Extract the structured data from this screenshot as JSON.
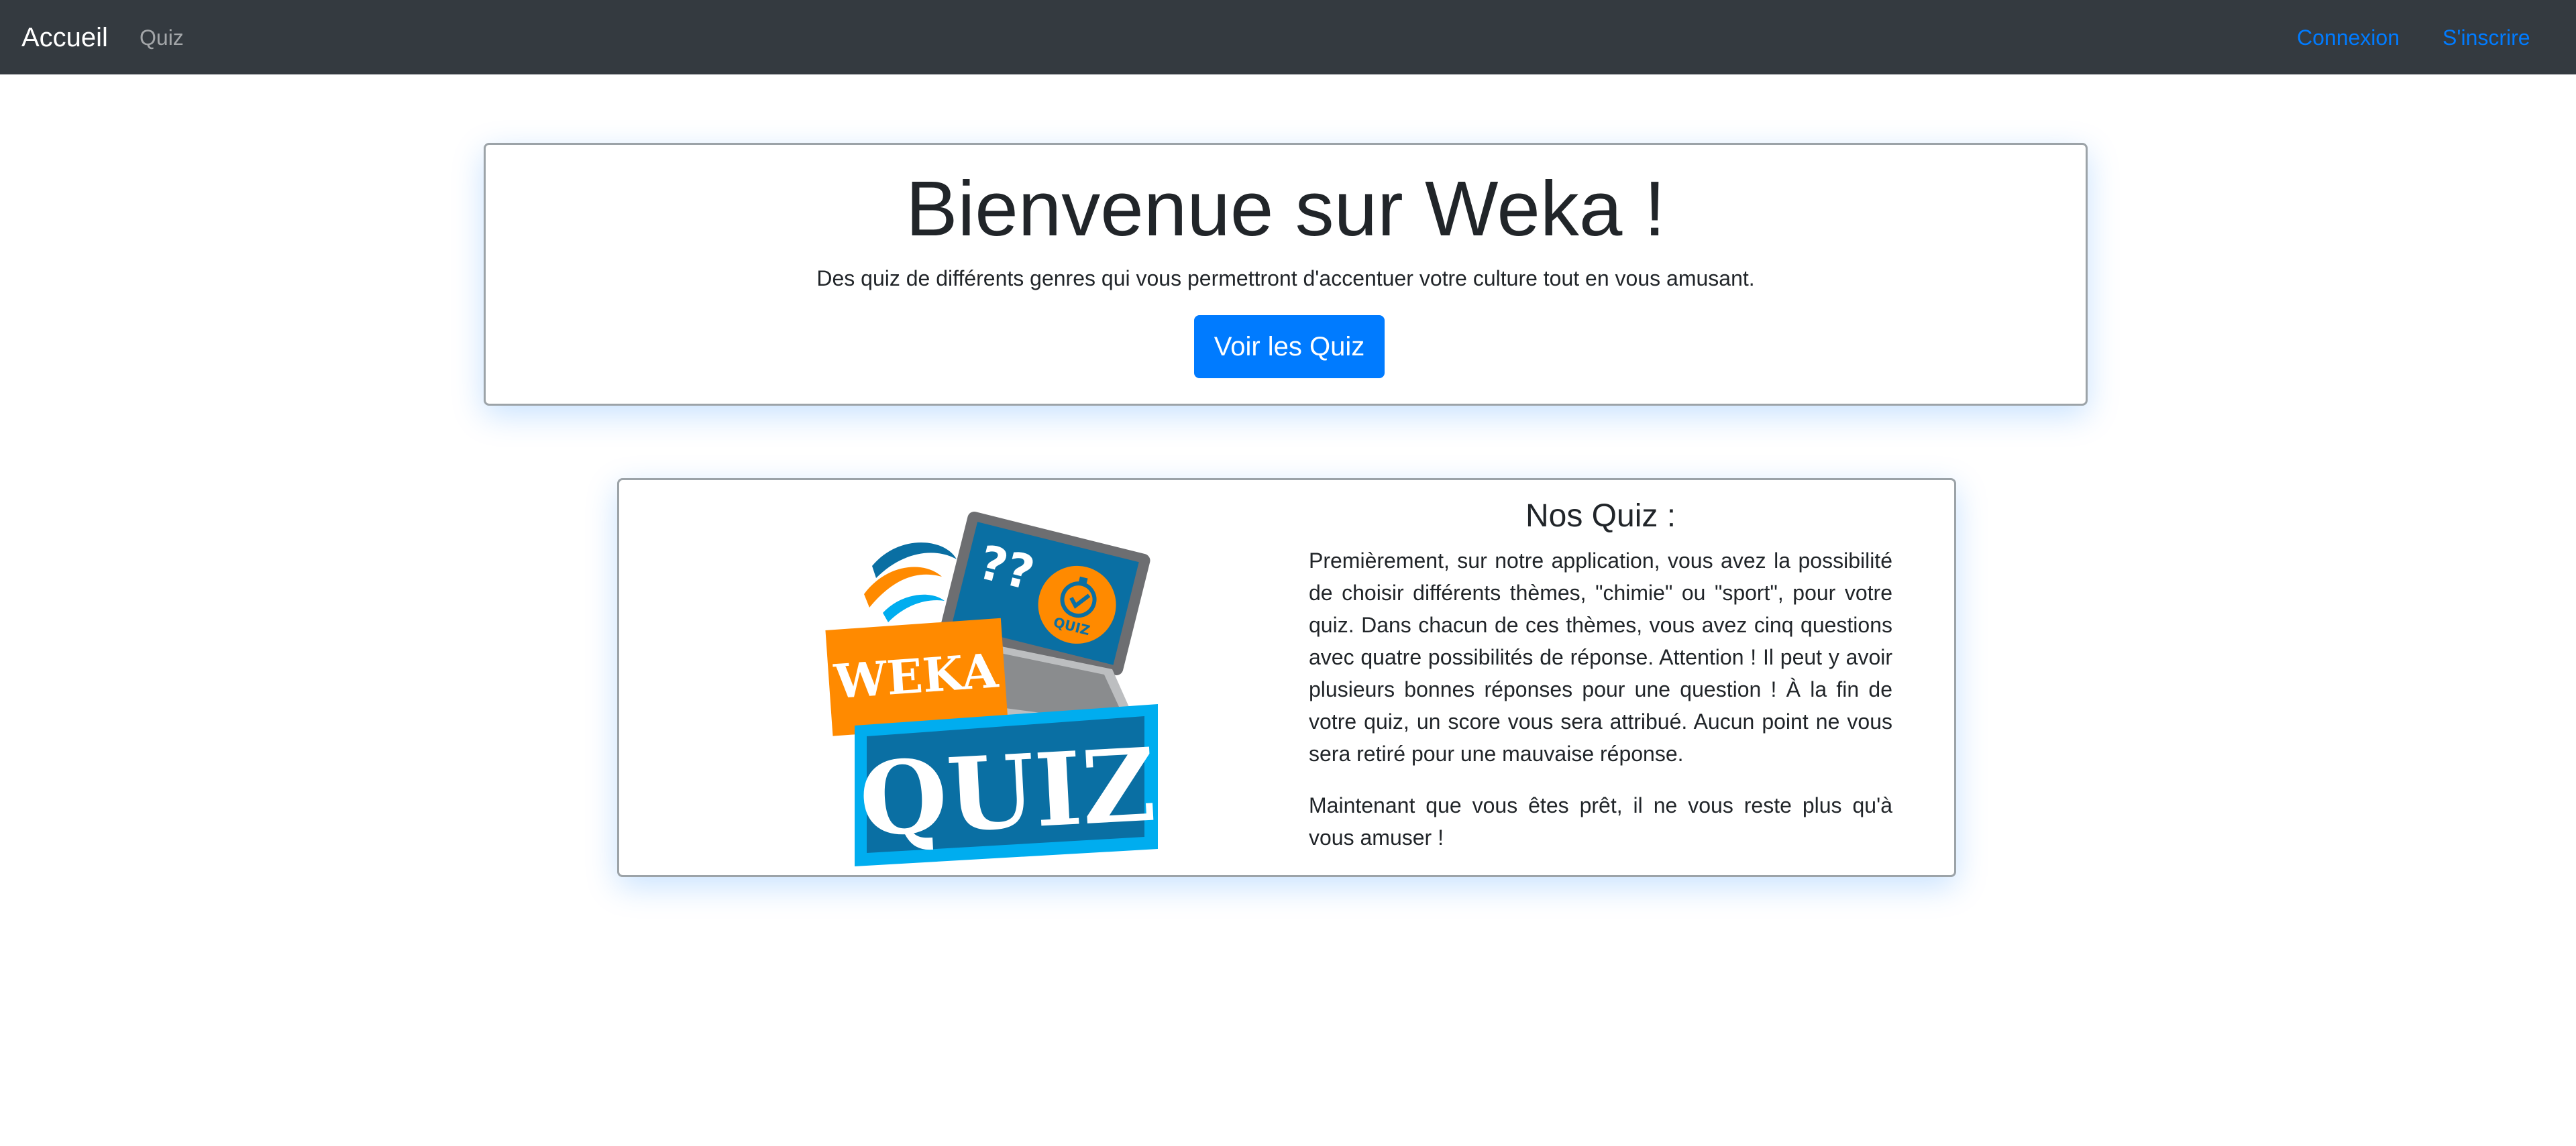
{
  "navbar": {
    "brand": "Accueil",
    "quiz_link": "Quiz",
    "login": "Connexion",
    "signup": "S'inscrire"
  },
  "hero": {
    "title": "Bienvenue sur Weka !",
    "subtitle": "Des quiz de différents genres qui vous permettront d'accentuer votre culture tout en vous amusant.",
    "button_label": "Voir les Quiz"
  },
  "info": {
    "title": "Nos Quiz :",
    "paragraph1": "Premièrement, sur notre application, vous avez la possibilité de choisir différents thèmes, \"chimie\" ou \"sport\", pour votre quiz. Dans chacun de ces thèmes, vous avez cinq questions avec quatre possibilités de réponse. Attention ! Il peut y avoir plusieurs bonnes réponses pour une question ! À la fin de votre quiz, un score vous sera attribué. Aucun point ne vous sera retiré pour une mauvaise réponse.",
    "paragraph2": "Maintenant que vous êtes prêt, il ne vous reste plus qu'à vous amuser !"
  },
  "logo": {
    "word_top": "WEKA",
    "word_bottom": "QUIZ",
    "screen_marks": "??",
    "badge_label": "QUIZ",
    "icon": "weka-quiz-logo"
  },
  "colors": {
    "navbar_bg": "#343a40",
    "primary": "#007bff",
    "logo_orange": "#ff8a00",
    "logo_blue": "#0a6fa3",
    "logo_light_blue": "#00adef"
  }
}
